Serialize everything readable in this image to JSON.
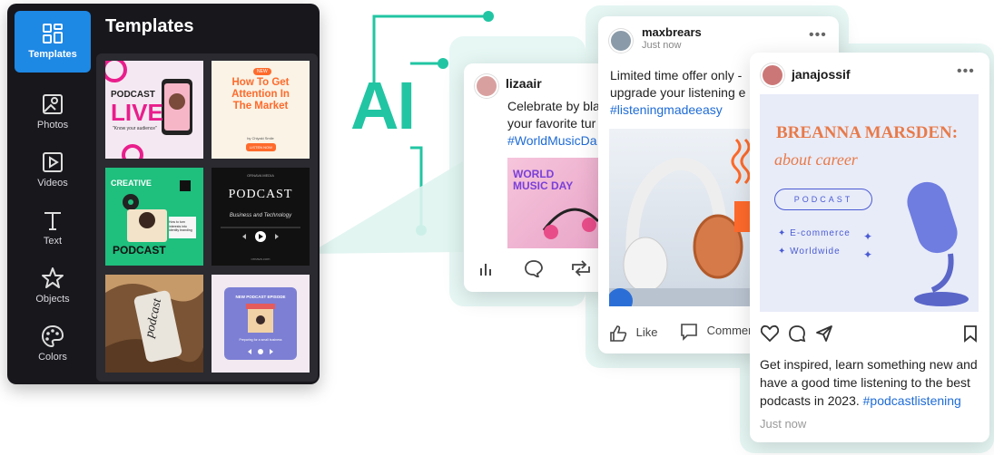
{
  "editor": {
    "title": "Templates",
    "rail": [
      {
        "label": "Templates",
        "icon": "templates-icon"
      },
      {
        "label": "Photos",
        "icon": "photos-icon"
      },
      {
        "label": "Videos",
        "icon": "videos-icon"
      },
      {
        "label": "Text",
        "icon": "text-icon"
      },
      {
        "label": "Objects",
        "icon": "objects-icon"
      },
      {
        "label": "Colors",
        "icon": "colors-icon"
      }
    ],
    "templates": [
      {
        "line1": "PODCAST",
        "line2": "LIVE",
        "line3": "\"Know your audience\""
      },
      {
        "badge": "NEW",
        "heading": "How To Get Attention In The Market",
        "sub": "by Chiyaki Smile",
        "cta": "LISTEN NOW"
      },
      {
        "line1": "CREATIVE",
        "line2": "PODCAST",
        "side": "How to turn interests into identity branding"
      },
      {
        "brand": "ORNAVA MEDIA",
        "title": "PODCAST",
        "sub": "Business and Technology",
        "foot": "ornava.com"
      },
      {
        "word": "podcast"
      },
      {
        "title": "NEW PODCAST EPISODE",
        "sub": "Preparing for a small business"
      }
    ]
  },
  "ai_label": "AI",
  "cards": [
    {
      "user": "lizaair",
      "text_lines": [
        "Celebrate by bla",
        "your favorite tur"
      ],
      "hashtag": "#WorldMusicDa",
      "image_text": [
        "WORLD",
        "MUSIC DAY"
      ]
    },
    {
      "user": "maxbrears",
      "time": "Just now",
      "text_lines": [
        "Limited time offer only -",
        "upgrade your listening e"
      ],
      "hashtag": "#listeningmadeeasy",
      "actions": {
        "like": "Like",
        "comment": "Commen"
      }
    },
    {
      "user": "janajossif",
      "image": {
        "name": "BREANNA MARSDEN:",
        "sub": "about career",
        "pill": "PODCAST",
        "bullets": [
          "E-commerce",
          "Worldwide"
        ]
      },
      "caption": "Get inspired, learn something new and have a good time listening to the best podcasts in 2023.",
      "caption_lines": [
        "Get inspired, learn something new and",
        "have a good time listening to the best",
        "podcasts in 2023. "
      ],
      "hashtag": "#podcastlistening",
      "time": "Just now"
    }
  ],
  "colors": {
    "accent": "#1e88e5",
    "teal": "#22c5a3",
    "link": "#1e6bd6",
    "panel": "#17171c"
  }
}
